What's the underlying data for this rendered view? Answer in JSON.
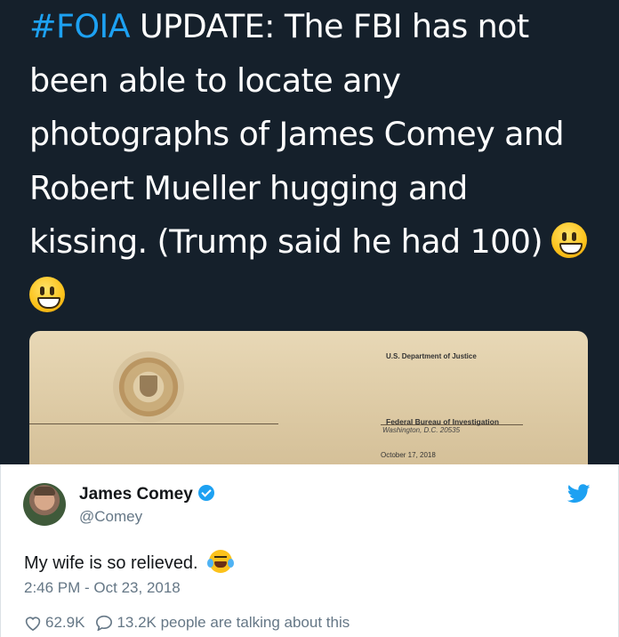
{
  "main_tweet": {
    "hashtag": "#FOIA",
    "text_line1_rest": " UPDATE: The FBI has not",
    "text_line2": "been able to locate any",
    "text_line3": "photographs of James Comey and",
    "text_line4": "Robert Mueller hugging and",
    "text_line5": "kissing. (Trump said he had 100)",
    "emoji": "grinning-face-emoji"
  },
  "document": {
    "department": "U.S. Department of Justice",
    "bureau": "Federal Bureau of Investigation",
    "address": "Washington, D.C. 20535",
    "date": "October 17, 2018"
  },
  "quote_tweet": {
    "name": "James Comey",
    "handle": "@Comey",
    "text": "My wife is so relieved.",
    "emoji": "tears-of-joy-emoji",
    "timestamp": "2:46 PM - Oct 23, 2018",
    "likes": "62.9K",
    "talking": "13.2K people are talking about this",
    "accent_color": "#1da1f2"
  },
  "colors": {
    "dark_background": "#15202b",
    "hashtag": "#1da1f2",
    "secondary_text": "#657786"
  }
}
